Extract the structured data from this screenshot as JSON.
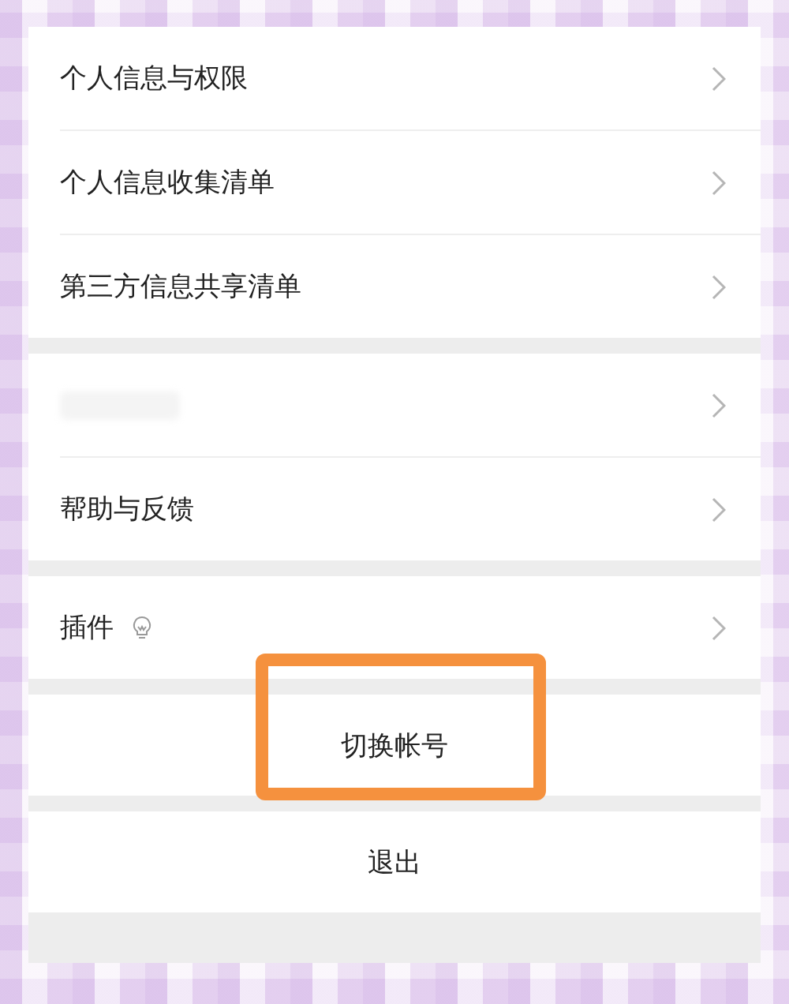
{
  "groups": [
    {
      "items": [
        {
          "kind": "link",
          "label": "个人信息与权限"
        },
        {
          "kind": "link",
          "label": "个人信息收集清单"
        },
        {
          "kind": "link",
          "label": "第三方信息共享清单"
        }
      ]
    },
    {
      "items": [
        {
          "kind": "blurred"
        },
        {
          "kind": "link",
          "label": "帮助与反馈"
        }
      ]
    },
    {
      "items": [
        {
          "kind": "link",
          "label": "插件",
          "has_icon": true
        }
      ]
    }
  ],
  "actions": [
    {
      "label": "切换帐号",
      "highlighted": true
    },
    {
      "label": "退出",
      "highlighted": false
    }
  ]
}
